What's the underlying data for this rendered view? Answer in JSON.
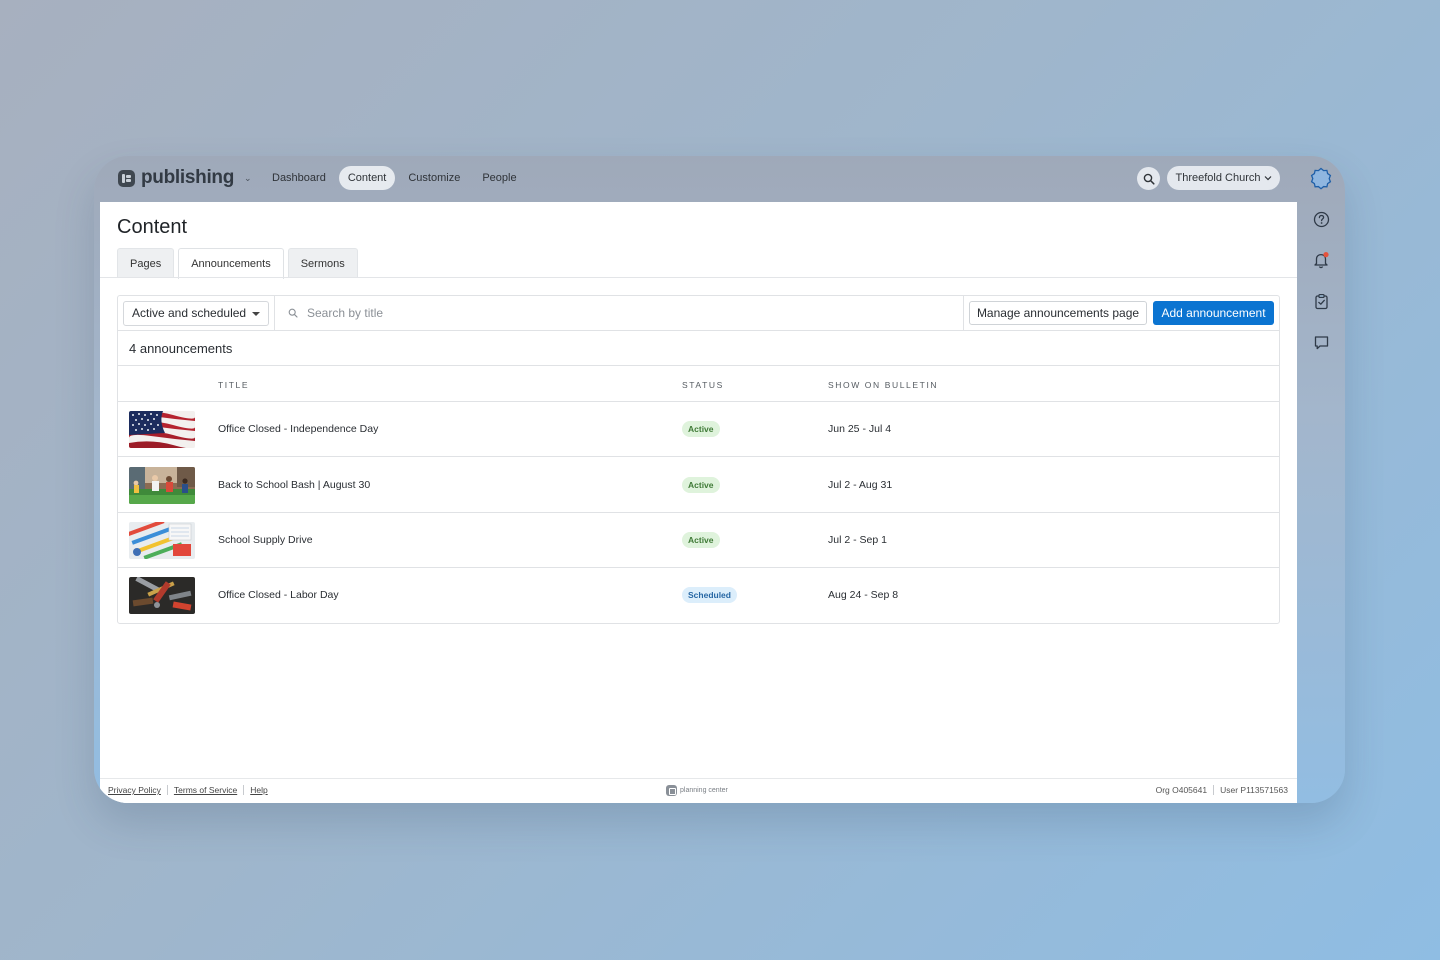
{
  "app": {
    "name": "publishing",
    "nav": [
      "Dashboard",
      "Content",
      "Customize",
      "People"
    ],
    "active_nav": "Content",
    "org_switcher": "Threefold Church"
  },
  "page": {
    "title": "Content",
    "tabs": [
      "Pages",
      "Announcements",
      "Sermons"
    ],
    "active_tab": "Announcements"
  },
  "toolbar": {
    "filter_value": "Active and scheduled",
    "search_placeholder": "Search by title",
    "manage_label": "Manage announcements page",
    "add_label": "Add announcement"
  },
  "summary": {
    "count_text": "4 announcements"
  },
  "table": {
    "headers": [
      "TITLE",
      "STATUS",
      "SHOW ON BULLETIN"
    ],
    "rows": [
      {
        "title": "Office Closed - Independence Day",
        "status": "Active",
        "dates": "Jun 25 - Jul 4",
        "thumb": "american-flag"
      },
      {
        "title": "Back to School Bash | August 30",
        "status": "Active",
        "dates": "Jul 2 - Aug 31",
        "thumb": "kids-playing"
      },
      {
        "title": "School Supply Drive",
        "status": "Active",
        "dates": "Jul 2 - Sep 1",
        "thumb": "school-supplies"
      },
      {
        "title": "Office Closed - Labor Day",
        "status": "Scheduled",
        "dates": "Aug 24 - Sep 8",
        "thumb": "work-tools"
      }
    ]
  },
  "footer": {
    "links": [
      "Privacy Policy",
      "Terms of Service",
      "Help"
    ],
    "brand": "planning center",
    "org_id": "Org O405641",
    "user_id": "User P113571563"
  },
  "colors": {
    "primary": "#0b74d1",
    "active_badge_bg": "#dff3dc",
    "active_badge_text": "#3f7a36",
    "scheduled_badge_bg": "#dceefb",
    "scheduled_badge_text": "#2667a4",
    "notification_dot": "#e5533d"
  }
}
